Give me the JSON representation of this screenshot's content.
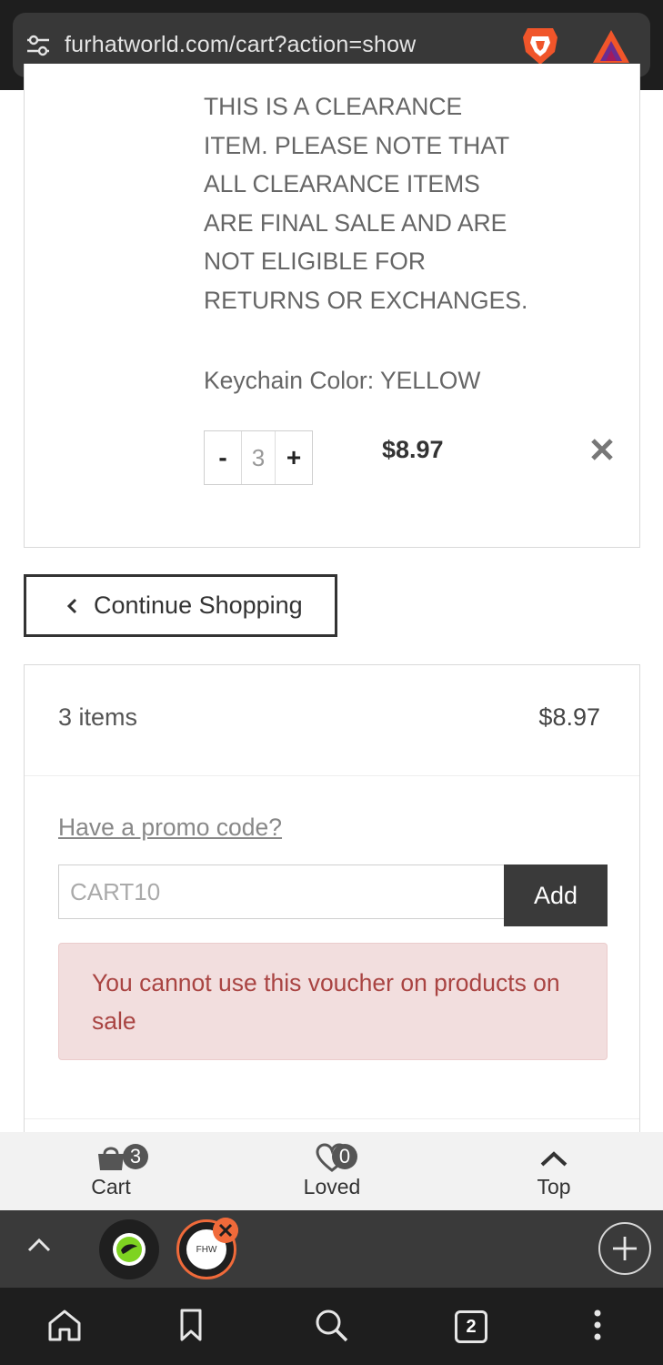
{
  "browser": {
    "url": "furhatworld.com/cart?action=show",
    "tab_count": "2"
  },
  "cart_item": {
    "notice": "THIS IS A CLEARANCE ITEM. PLEASE NOTE THAT ALL CLEARANCE ITEMS ARE FINAL SALE AND ARE NOT ELIGIBLE FOR RETURNS OR EXCHANGES.",
    "variant": "Keychain Color: YELLOW",
    "qty_minus": "-",
    "qty_value": "3",
    "qty_plus": "+",
    "price": "$8.97"
  },
  "continue_label": "Continue Shopping",
  "summary": {
    "item_count": "3 items",
    "total": "$8.97",
    "promo_link": "Have a promo code?",
    "promo_value": "CART10",
    "add_label": "Add",
    "error": "You cannot use this voucher on products on sale"
  },
  "site_nav": {
    "cart_label": "Cart",
    "cart_count": "3",
    "loved_label": "Loved",
    "loved_count": "0",
    "top_label": "Top"
  },
  "tab_favicon_text": "FHW",
  "icons": {
    "url_settings": "tune-icon",
    "shield": "brave-lion-icon",
    "rewards": "bat-triangle-icon"
  },
  "colors": {
    "alert_bg": "#f2dede",
    "alert_text": "#a94442",
    "active_tab": "#f06a3a"
  }
}
